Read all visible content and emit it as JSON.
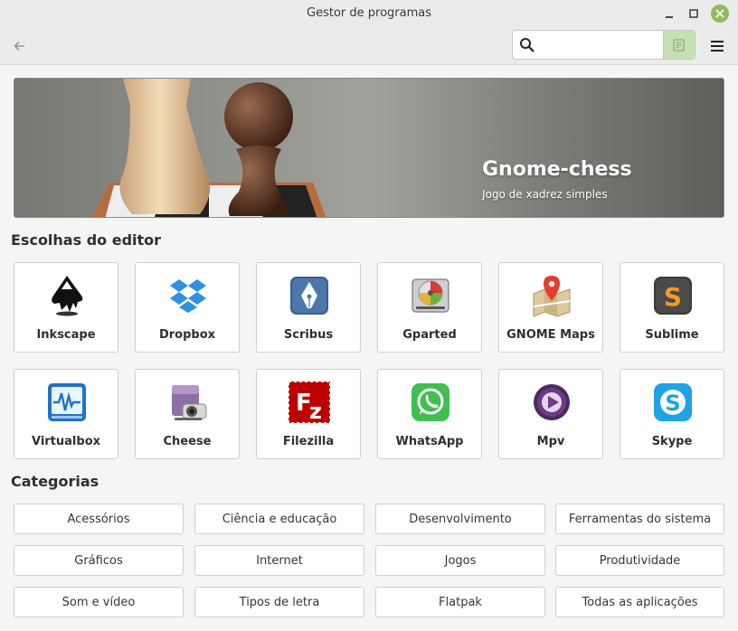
{
  "window": {
    "title": "Gestor de programas"
  },
  "search": {
    "value": "",
    "placeholder": ""
  },
  "banner": {
    "title": "Gnome-chess",
    "subtitle": "Jogo de xadrez simples"
  },
  "editor_picks": {
    "heading": "Escolhas do editor",
    "apps": [
      {
        "name": "Inkscape",
        "icon": "inkscape-icon"
      },
      {
        "name": "Dropbox",
        "icon": "dropbox-icon"
      },
      {
        "name": "Scribus",
        "icon": "scribus-icon"
      },
      {
        "name": "Gparted",
        "icon": "gparted-icon"
      },
      {
        "name": "GNOME Maps",
        "icon": "gnome-maps-icon"
      },
      {
        "name": "Sublime",
        "icon": "sublime-icon"
      },
      {
        "name": "Virtualbox",
        "icon": "virtualbox-icon"
      },
      {
        "name": "Cheese",
        "icon": "cheese-icon"
      },
      {
        "name": "Filezilla",
        "icon": "filezilla-icon"
      },
      {
        "name": "WhatsApp",
        "icon": "whatsapp-icon"
      },
      {
        "name": "Mpv",
        "icon": "mpv-icon"
      },
      {
        "name": "Skype",
        "icon": "skype-icon"
      }
    ]
  },
  "categories": {
    "heading": "Categorias",
    "items": [
      "Acessórios",
      "Ciência e educação",
      "Desenvolvimento",
      "Ferramentas do sistema",
      "Gráficos",
      "Internet",
      "Jogos",
      "Produtividade",
      "Som e vídeo",
      "Tipos de letra",
      "Flatpak",
      "Todas as aplicações"
    ]
  },
  "colors": {
    "accent": "#8fbc5e",
    "search_toggle": "#c5e1b3"
  }
}
